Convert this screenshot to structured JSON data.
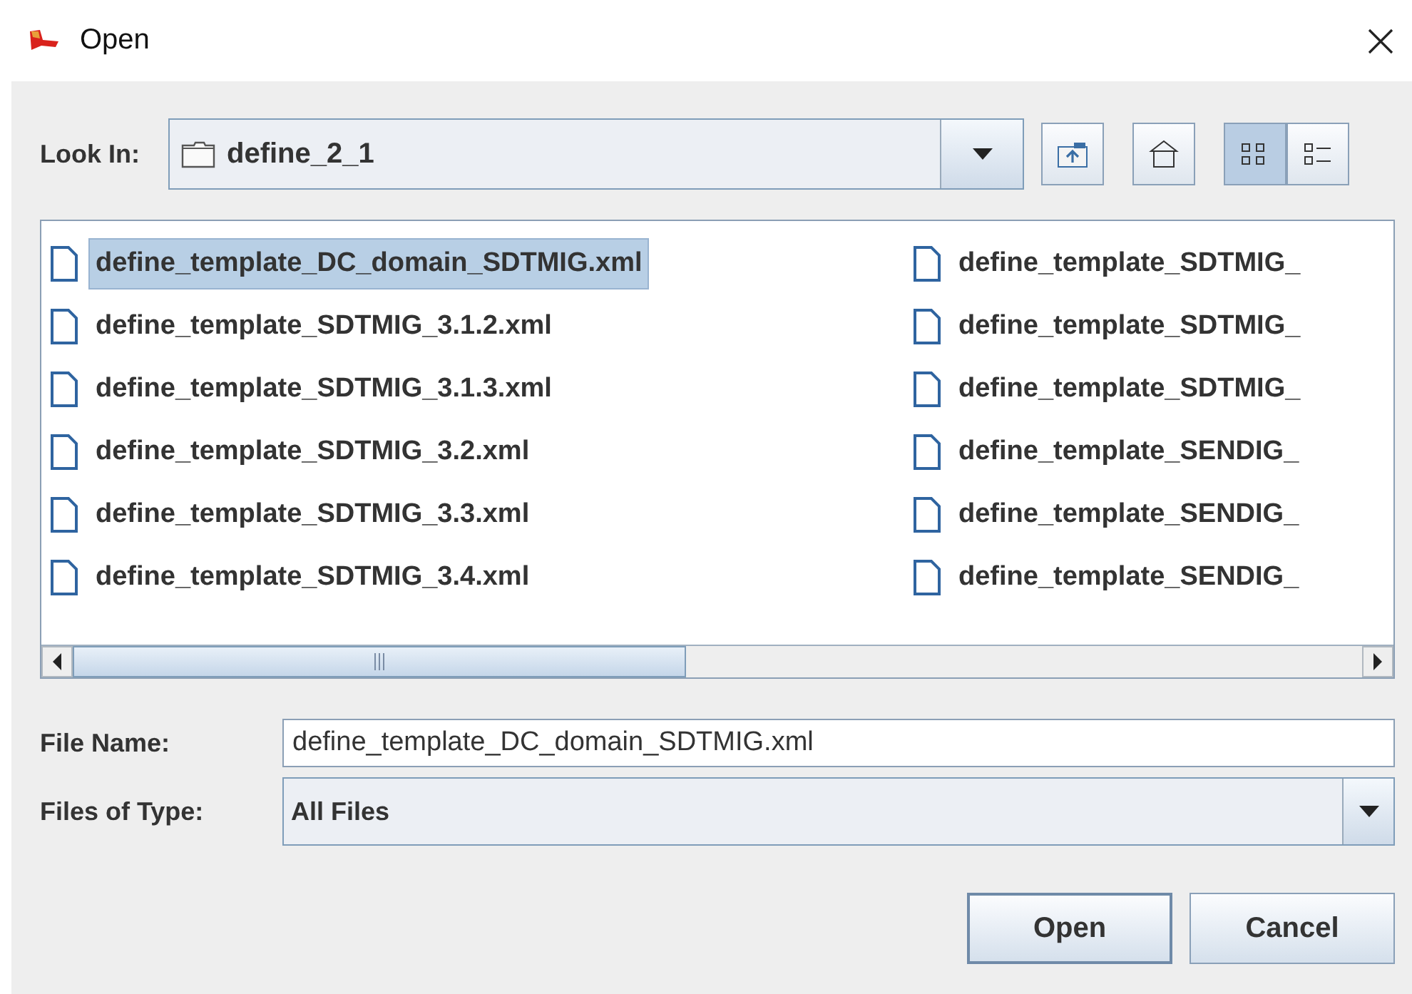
{
  "window": {
    "title": "Open"
  },
  "look_in": {
    "label": "Look In:",
    "value": "define_2_1"
  },
  "toolbar": [
    {
      "kind": "up",
      "selected": false
    },
    {
      "kind": "home",
      "selected": false
    },
    {
      "kind": "list",
      "selected": true
    },
    {
      "kind": "details",
      "selected": false
    }
  ],
  "files": [
    {
      "name": "define_template_DC_domain_SDTMIG.xml",
      "selected": true
    },
    {
      "name": "define_template_SDTMIG_3.1.2.xml",
      "selected": false
    },
    {
      "name": "define_template_SDTMIG_3.1.3.xml",
      "selected": false
    },
    {
      "name": "define_template_SDTMIG_3.2.xml",
      "selected": false
    },
    {
      "name": "define_template_SDTMIG_3.3.xml",
      "selected": false
    },
    {
      "name": "define_template_SDTMIG_3.4.xml",
      "selected": false
    },
    {
      "name": "define_template_SDTMIG_",
      "selected": false
    },
    {
      "name": "define_template_SDTMIG_",
      "selected": false
    },
    {
      "name": "define_template_SDTMIG_",
      "selected": false
    },
    {
      "name": "define_template_SENDIG_",
      "selected": false
    },
    {
      "name": "define_template_SENDIG_",
      "selected": false
    },
    {
      "name": "define_template_SENDIG_",
      "selected": false
    }
  ],
  "file_name": {
    "label": "File Name:",
    "value": "define_template_DC_domain_SDTMIG.xml"
  },
  "files_of_type": {
    "label": "Files of Type:",
    "value": "All Files"
  },
  "buttons": [
    {
      "label": "Open",
      "default": true
    },
    {
      "label": "Cancel",
      "default": false
    }
  ]
}
